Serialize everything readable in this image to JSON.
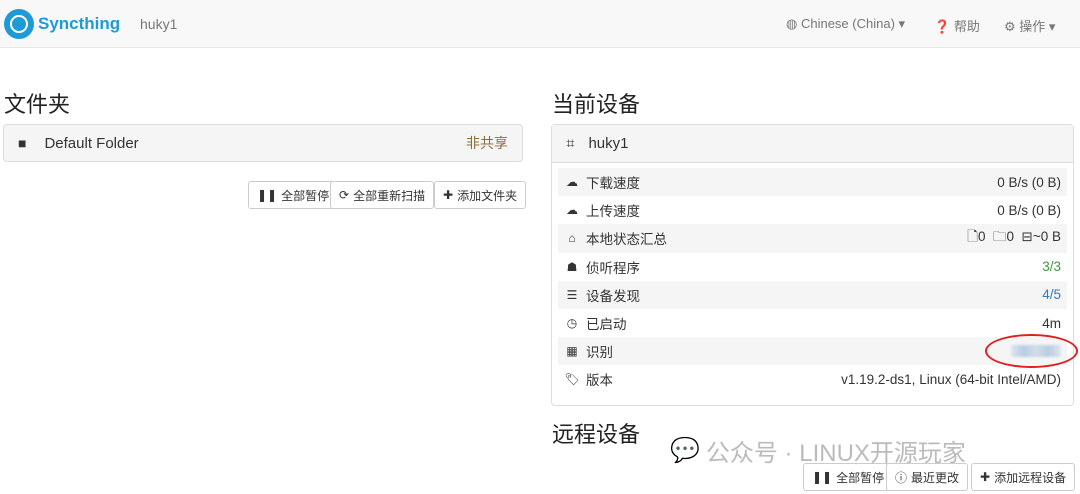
{
  "nav": {
    "brand": "Syncthing",
    "device": "huky1",
    "language": "Chinese (China)",
    "help": "帮助",
    "actions": "操作"
  },
  "folders": {
    "title": "文件夹",
    "items": [
      {
        "name": "Default Folder",
        "status": "非共享"
      }
    ],
    "pause_all": "全部暂停",
    "rescan_all": "全部重新扫描",
    "add_folder": "添加文件夹"
  },
  "this_device": {
    "title": "当前设备",
    "name": "huky1",
    "rows": [
      {
        "icon": "cloud-download-icon",
        "label": "下载速度",
        "value": "0 B/s (0 B)"
      },
      {
        "icon": "cloud-upload-icon",
        "label": "上传速度",
        "value": "0 B/s (0 B)"
      },
      {
        "icon": "home-icon",
        "label": "本地状态汇总",
        "files": "0",
        "dirs": "0",
        "size": "~0 B"
      },
      {
        "icon": "sitemap-icon",
        "label": "侦听程序",
        "value": "3/3"
      },
      {
        "icon": "signpost-icon",
        "label": "设备发现",
        "value": "4/5"
      },
      {
        "icon": "clock-icon",
        "label": "已启动",
        "value": "4m"
      },
      {
        "icon": "qrcode-icon",
        "label": "识别",
        "value": ""
      },
      {
        "icon": "tag-icon",
        "label": "版本",
        "value": "v1.19.2-ds1, Linux (64-bit Intel/AMD)"
      }
    ]
  },
  "remote": {
    "title": "远程设备",
    "pause_all": "全部暂停",
    "recent_changes": "最近更改",
    "add_remote": "添加远程设备"
  },
  "watermark": "公众号 · LINUX开源玩家",
  "colors": {
    "brand": "#1e9ad6",
    "ok": "#3c9a3c",
    "info": "#337ab7",
    "unshared": "#8a6d3b"
  }
}
